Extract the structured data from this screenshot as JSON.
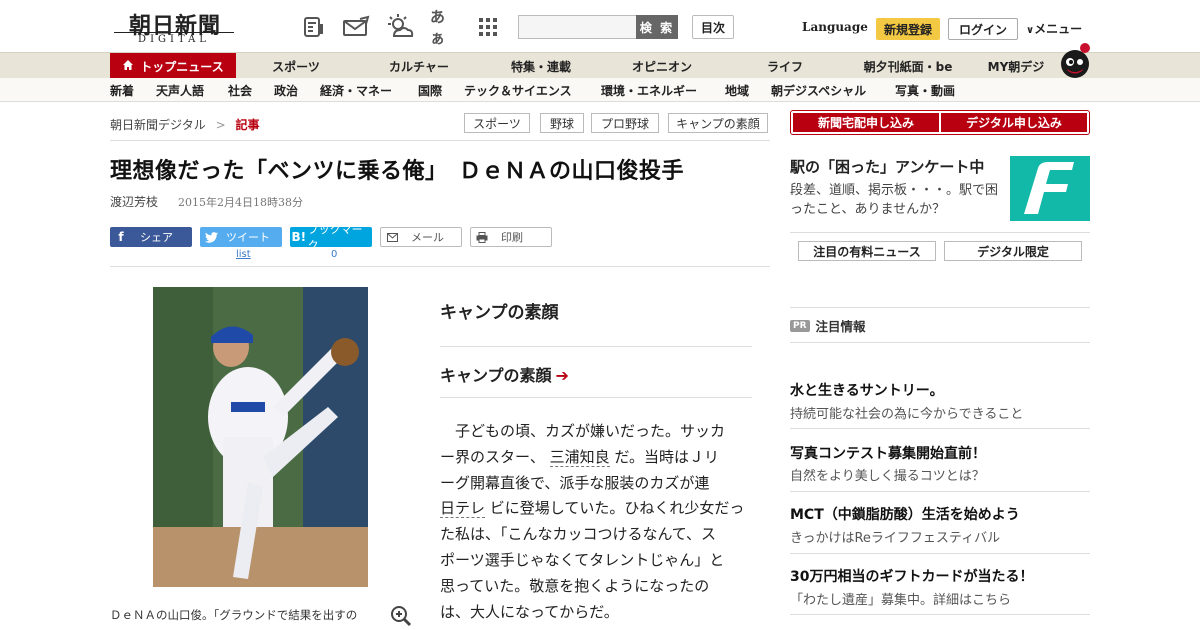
{
  "header": {
    "logo_main": "朝日新聞",
    "logo_sub": "DIGITAL",
    "icons": [
      "newspaper-icon",
      "mail-icon",
      "weather-icon",
      "font-size-icon",
      "grid-apps-icon"
    ],
    "font_icon_text": "あぁ",
    "search_placeholder": "",
    "search_button": "検 索",
    "toc_button": "目次",
    "language": "Language",
    "signup": "新規登録",
    "login": "ログイン",
    "menu": "メニュー"
  },
  "nav_primary": [
    "トップニュース",
    "スポーツ",
    "カルチャー",
    "特集・連載",
    "オピニオン",
    "ライフ",
    "朝夕刊紙面・be",
    "MY朝デジ"
  ],
  "nav_secondary": [
    "新着",
    "天声人語",
    "社会",
    "政治",
    "経済・マネー",
    "国際",
    "テック＆サイエンス",
    "環境・エネルギー",
    "地域",
    "朝デジスペシャル",
    "写真・動画"
  ],
  "breadcrumb": {
    "home": "朝日新聞デジタル",
    "separator": ">",
    "current": "記事"
  },
  "tags": [
    "スポーツ",
    "野球",
    "プロ野球",
    "キャンプの素顔"
  ],
  "article": {
    "title": "理想像だった「ベンツに乗る俺」　ＤｅＮＡの山口俊投手",
    "author": "渡辺芳枝",
    "date": "2015年2月4日18時38分",
    "share": {
      "facebook": "シェア",
      "twitter": "ツイート",
      "twitter_count": "list",
      "hatena": "ブックマーク",
      "hatena_count": "0",
      "mail": "メール",
      "print": "印刷"
    },
    "photo_caption": "ＤｅＮＡの山口俊。「グラウンドで結果を出すの",
    "section_title": "キャンプの素顔",
    "section_link": "キャンプの素顔",
    "body_lines": [
      "　子どもの頃、カズが嫌いだった。サッカ",
      "ー界のスター、",
      "三浦知良",
      "だ。当時はＪリ",
      "ーグ開幕直後で、派手な服装のカズが連",
      "日テレ",
      "ビに登場していた。ひねくれ少女だっ",
      "た私は、「こんなカッコつけるなんて、ス",
      "ポーツ選手じゃなくてタレントじゃん」と",
      "思っていた。敬意を抱くようになったの",
      "は、大人になってからだ。"
    ]
  },
  "sidebar": {
    "subscribe_paper": "新聞宅配申し込み",
    "subscribe_digital": "デジタル申し込み",
    "ad_title": "駅の「困った」アンケート中",
    "ad_text": "段差、道順、掲示板・・・。駅で困ったこと、ありませんか？",
    "btn_premium": "注目の有料ニュース",
    "btn_digital": "デジタル限定",
    "pr_badge": "PR",
    "pr_heading": "注目情報",
    "pr_items": [
      {
        "title": "水と生きるサントリー。",
        "desc": "持続可能な社会の為に今からできること"
      },
      {
        "title": "写真コンテスト募集開始直前！",
        "desc": "自然をより美しく撮るコツとは？"
      },
      {
        "title": "MCT（中鎖脂肪酸）生活を始めよう",
        "desc": "きっかけはReライフフェスティバル"
      },
      {
        "title": "30万円相当のギフトカードが当たる！",
        "desc": "「わたし遺産」募集中。詳細はこちら"
      }
    ]
  },
  "colors": {
    "brand_red": "#b80010",
    "signup_yellow": "#f3c843",
    "facebook": "#3b5998",
    "twitter": "#55acee",
    "hatena": "#00a4de",
    "ad_teal": "#12b8a8"
  }
}
